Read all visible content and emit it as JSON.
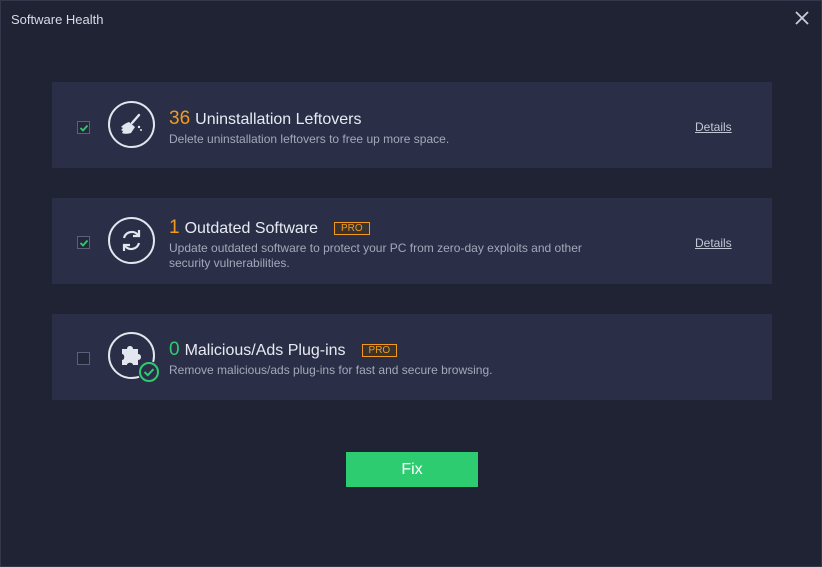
{
  "window": {
    "title": "Software Health",
    "close_icon": "close-icon"
  },
  "items": [
    {
      "checked": true,
      "icon": "broom-icon",
      "count": "36",
      "count_color": "#f39a1e",
      "title": "Uninstallation Leftovers",
      "pro": false,
      "description": "Delete uninstallation leftovers to free up more space.",
      "details_label": "Details"
    },
    {
      "checked": true,
      "icon": "refresh-icon",
      "count": "1",
      "count_color": "#f39a1e",
      "title": "Outdated Software",
      "pro": true,
      "pro_label": "PRO",
      "description": "Update outdated software to protect your PC from zero-day exploits and other security vulnerabilities.",
      "details_label": "Details"
    },
    {
      "checked": false,
      "icon": "puzzle-piece-icon",
      "status_icon": "check-circle-icon",
      "count": "0",
      "count_color": "#2ecc71",
      "title": "Malicious/Ads Plug-ins",
      "pro": true,
      "pro_label": "PRO",
      "description": "Remove malicious/ads plug-ins for fast and secure browsing."
    }
  ],
  "fix_button": {
    "label": "Fix"
  },
  "colors": {
    "accent_green": "#2ecc71",
    "accent_orange": "#f39a1e",
    "card_bg": "#2a2f47",
    "window_bg": "#1f2334"
  }
}
